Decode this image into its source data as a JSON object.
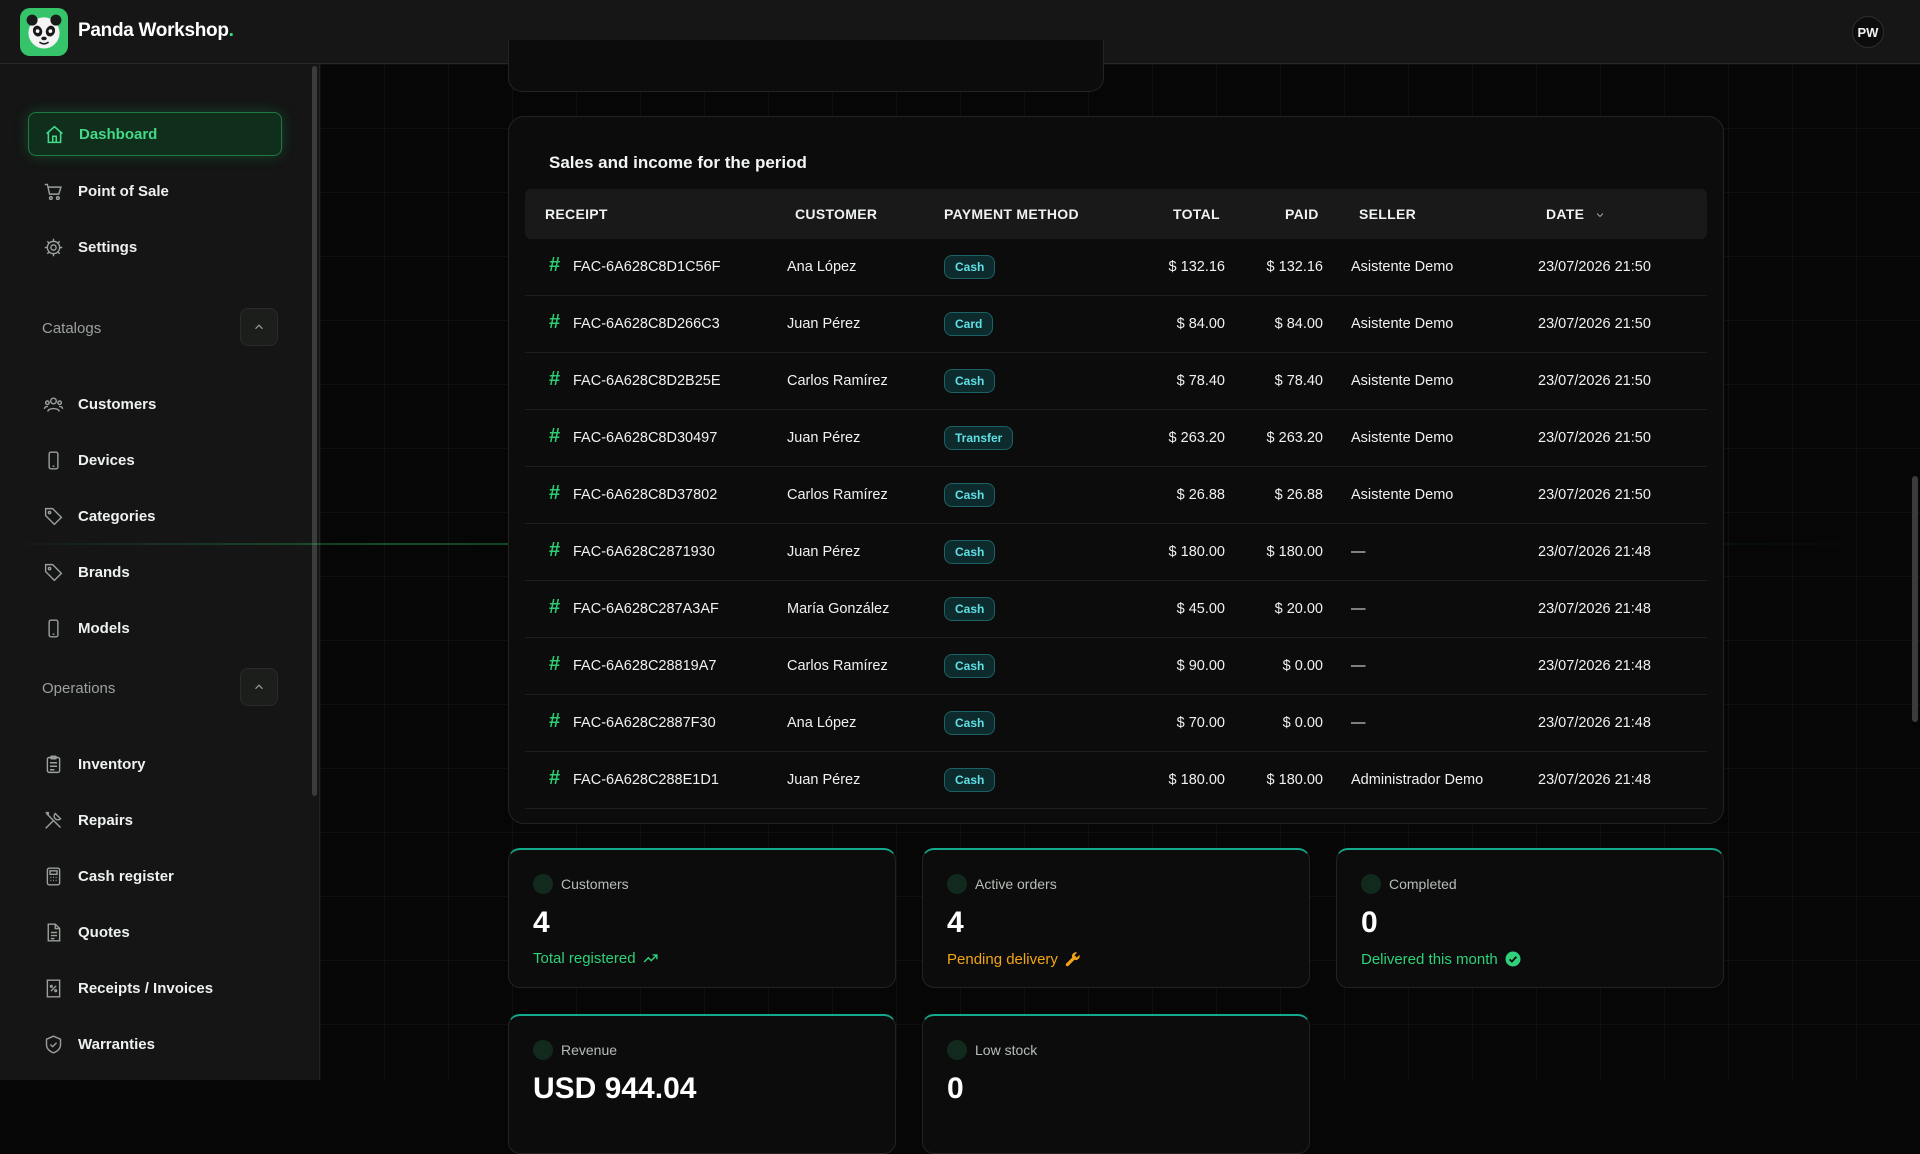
{
  "app": {
    "brand_name": "Panda Workshop",
    "brand_dot": ".",
    "avatar_initials": "PW"
  },
  "sidebar": {
    "top_items": [
      {
        "label": "Dashboard",
        "icon": "home-icon",
        "active": true
      },
      {
        "label": "Point of Sale",
        "icon": "cart-icon"
      },
      {
        "label": "Settings",
        "icon": "gear-icon"
      }
    ],
    "catalogs": {
      "label": "Catalogs",
      "items": [
        {
          "label": "Customers",
          "icon": "users-icon"
        },
        {
          "label": "Devices",
          "icon": "phone-icon"
        },
        {
          "label": "Categories",
          "icon": "tag-icon"
        },
        {
          "label": "Brands",
          "icon": "tag-icon"
        },
        {
          "label": "Models",
          "icon": "phone-icon"
        }
      ]
    },
    "operations": {
      "label": "Operations",
      "items": [
        {
          "label": "Inventory",
          "icon": "clipboard-icon"
        },
        {
          "label": "Repairs",
          "icon": "tools-icon"
        },
        {
          "label": "Cash register",
          "icon": "calculator-icon"
        },
        {
          "label": "Quotes",
          "icon": "document-icon"
        },
        {
          "label": "Receipts / Invoices",
          "icon": "receipt-icon"
        },
        {
          "label": "Warranties",
          "icon": "shield-icon"
        }
      ]
    }
  },
  "sales": {
    "title": "Sales and income for the period",
    "columns": [
      "RECEIPT",
      "CUSTOMER",
      "PAYMENT METHOD",
      "TOTAL",
      "PAID",
      "SELLER",
      "DATE"
    ],
    "rows": [
      {
        "receipt": "FAC-6A628C8D1C56F",
        "customer": "Ana López",
        "method": "Cash",
        "total": "$ 132.16",
        "paid": "$ 132.16",
        "seller": "Asistente Demo",
        "date": "23/07/2026 21:50"
      },
      {
        "receipt": "FAC-6A628C8D266C3",
        "customer": "Juan Pérez",
        "method": "Card",
        "total": "$ 84.00",
        "paid": "$ 84.00",
        "seller": "Asistente Demo",
        "date": "23/07/2026 21:50"
      },
      {
        "receipt": "FAC-6A628C8D2B25E",
        "customer": "Carlos Ramírez",
        "method": "Cash",
        "total": "$ 78.40",
        "paid": "$ 78.40",
        "seller": "Asistente Demo",
        "date": "23/07/2026 21:50"
      },
      {
        "receipt": "FAC-6A628C8D30497",
        "customer": "Juan Pérez",
        "method": "Transfer",
        "total": "$ 263.20",
        "paid": "$ 263.20",
        "seller": "Asistente Demo",
        "date": "23/07/2026 21:50"
      },
      {
        "receipt": "FAC-6A628C8D37802",
        "customer": "Carlos Ramírez",
        "method": "Cash",
        "total": "$ 26.88",
        "paid": "$ 26.88",
        "seller": "Asistente Demo",
        "date": "23/07/2026 21:50"
      },
      {
        "receipt": "FAC-6A628C2871930",
        "customer": "Juan Pérez",
        "method": "Cash",
        "total": "$ 180.00",
        "paid": "$ 180.00",
        "seller": "—",
        "date": "23/07/2026 21:48"
      },
      {
        "receipt": "FAC-6A628C287A3AF",
        "customer": "María González",
        "method": "Cash",
        "total": "$ 45.00",
        "paid": "$ 20.00",
        "seller": "—",
        "date": "23/07/2026 21:48"
      },
      {
        "receipt": "FAC-6A628C28819A7",
        "customer": "Carlos Ramírez",
        "method": "Cash",
        "total": "$ 90.00",
        "paid": "$ 0.00",
        "seller": "—",
        "date": "23/07/2026 21:48"
      },
      {
        "receipt": "FAC-6A628C2887F30",
        "customer": "Ana López",
        "method": "Cash",
        "total": "$ 70.00",
        "paid": "$ 0.00",
        "seller": "—",
        "date": "23/07/2026 21:48"
      },
      {
        "receipt": "FAC-6A628C288E1D1",
        "customer": "Juan Pérez",
        "method": "Cash",
        "total": "$ 180.00",
        "paid": "$ 180.00",
        "seller": "Administrador Demo",
        "date": "23/07/2026 21:48"
      }
    ]
  },
  "stats": [
    {
      "label": "Customers",
      "value": "4",
      "sub": "Total registered",
      "sub_color": "#2fd17a",
      "icon": "trending-up-icon"
    },
    {
      "label": "Active orders",
      "value": "4",
      "sub": "Pending delivery",
      "sub_color": "#f2a516",
      "icon": "wrench-icon"
    },
    {
      "label": "Completed",
      "value": "0",
      "sub": "Delivered this month",
      "sub_color": "#2fd17a",
      "icon": "check-circle-icon"
    },
    {
      "label": "Revenue",
      "value": "USD 944.04",
      "sub": "",
      "sub_color": "#2fd17a",
      "icon": ""
    },
    {
      "label": "Low stock",
      "value": "0",
      "sub": "",
      "sub_color": "#2fd17a",
      "icon": ""
    }
  ],
  "colors": {
    "accent": "#3ddc84",
    "pill_text": "#5fe0e6",
    "warning": "#f2a516"
  }
}
